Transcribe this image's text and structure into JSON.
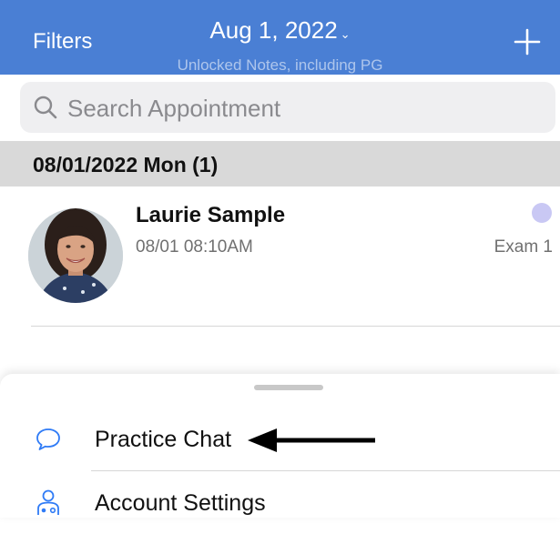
{
  "header": {
    "filters_label": "Filters",
    "date": "Aug 1, 2022",
    "date_chevron": "⌄",
    "subtitle": "Unlocked Notes, including PG",
    "add_icon": "plus-icon",
    "background_color": "#4a7fd4"
  },
  "search": {
    "placeholder": "Search Appointment",
    "value": "",
    "icon": "search-icon"
  },
  "section": {
    "title": "08/01/2022 Mon (1)"
  },
  "appointments": [
    {
      "patient_name": "Laurie Sample",
      "time": "08/01 08:10AM",
      "room": "Exam 1",
      "status_color": "#c9c8f4",
      "avatar": "patient-photo"
    }
  ],
  "bottom_sheet": {
    "items": [
      {
        "label": "Practice Chat",
        "icon": "chat-bubble-icon",
        "icon_color": "#2f7bf6"
      },
      {
        "label": "Account Settings",
        "icon": "account-settings-icon",
        "icon_color": "#2f7bf6"
      }
    ]
  },
  "annotation": {
    "arrow": "left-arrow-pointer"
  }
}
